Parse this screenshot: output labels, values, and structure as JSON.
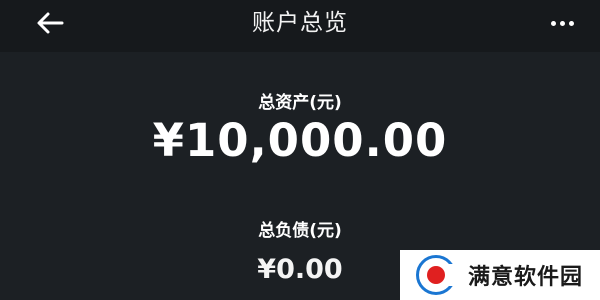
{
  "header": {
    "title": "账户总览",
    "back_icon": "arrow-left-icon",
    "more_icon": "more-horizontal-icon"
  },
  "summary": {
    "total_assets_label": "总资产(元)",
    "total_assets_value": "¥10,000.00",
    "total_debts_label": "总负债(元)",
    "total_debts_value": "¥0.00"
  },
  "watermark": {
    "text": "满意软件园"
  },
  "colors": {
    "background": "#1c2024",
    "header_background": "#16191c",
    "text": "#ffffff",
    "watermark_blue": "#1a76d2",
    "watermark_red": "#e02020"
  }
}
